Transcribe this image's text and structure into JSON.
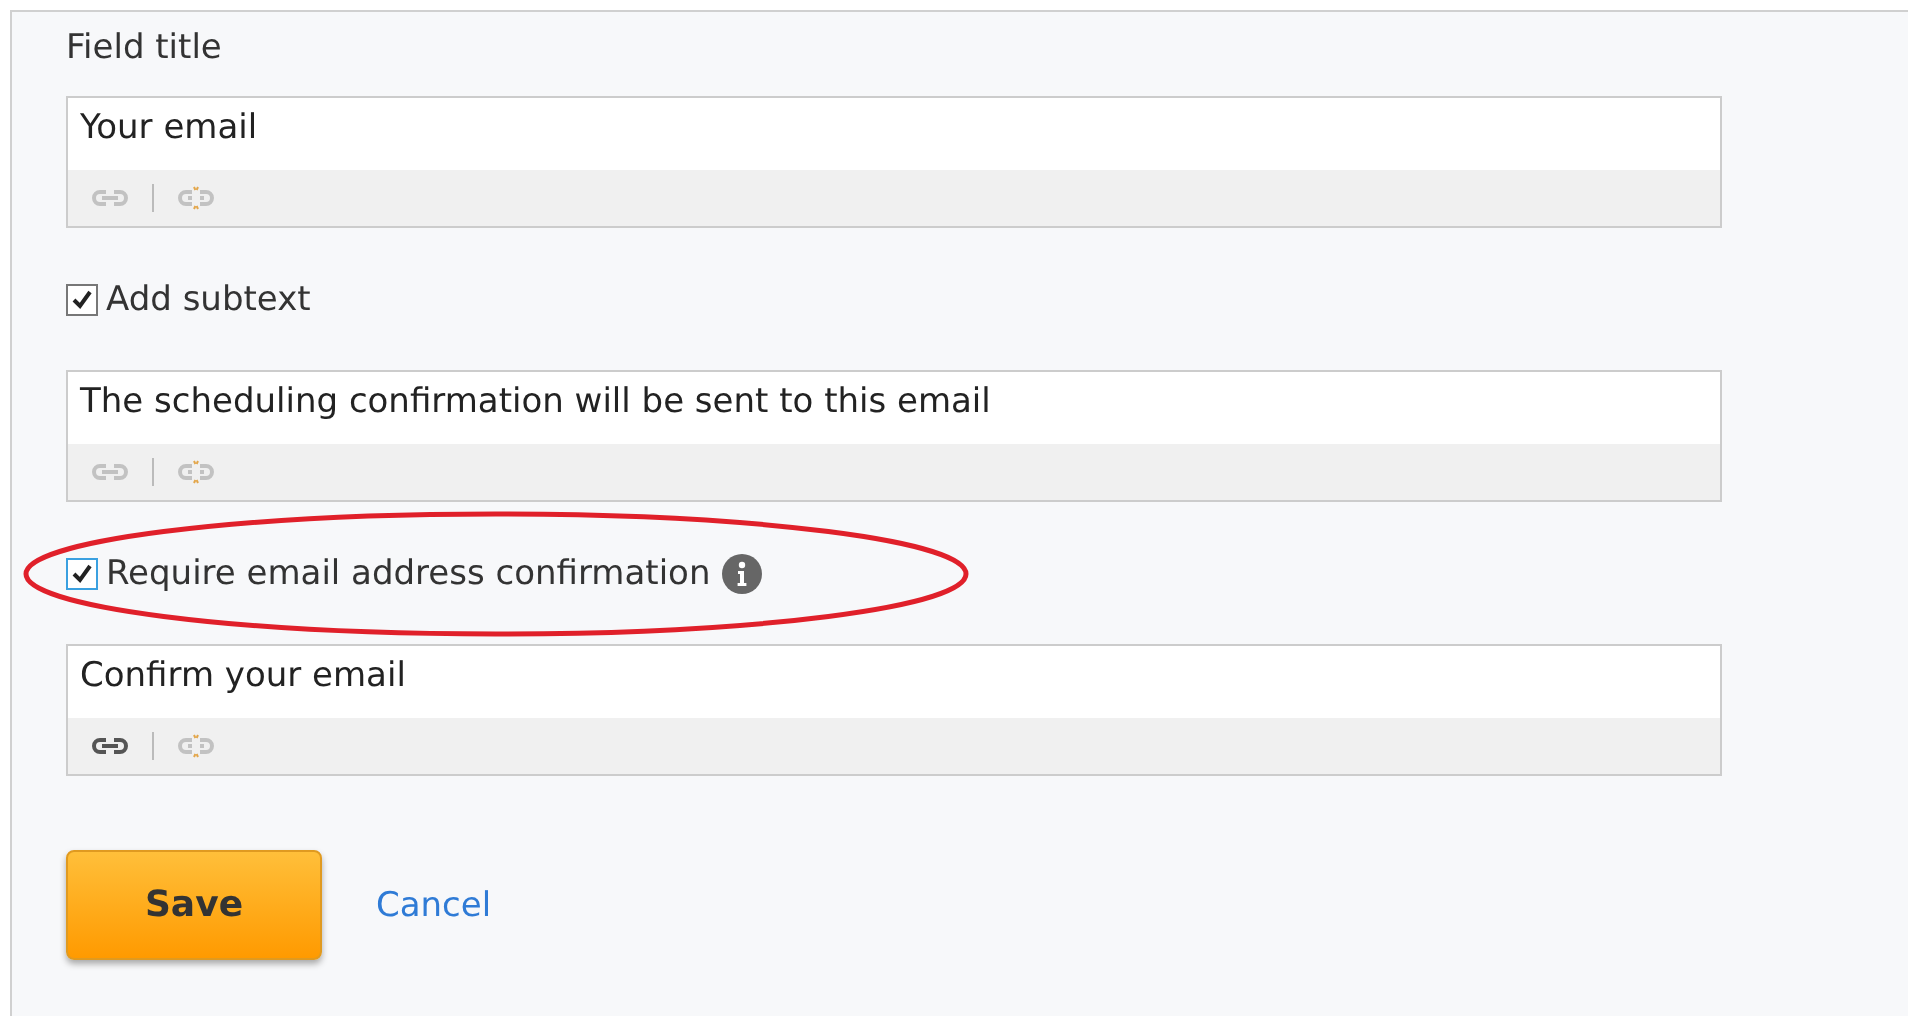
{
  "items": [
    {
      "kind": "label",
      "text": "Field title"
    },
    {
      "kind": "field",
      "value": "Your email",
      "link_active": false
    },
    {
      "kind": "checkbox",
      "label": "Add subtext",
      "checked": true,
      "focused": false,
      "info": false,
      "highlighted": false
    },
    {
      "kind": "field",
      "value": "The scheduling confirmation will be sent to this email",
      "link_active": false
    },
    {
      "kind": "checkbox",
      "label": "Require email address confirmation",
      "checked": true,
      "focused": true,
      "info": true,
      "highlighted": true
    },
    {
      "kind": "field",
      "value": "Confirm your email",
      "link_active": true
    }
  ],
  "buttons": {
    "save": "Save",
    "cancel": "Cancel"
  }
}
